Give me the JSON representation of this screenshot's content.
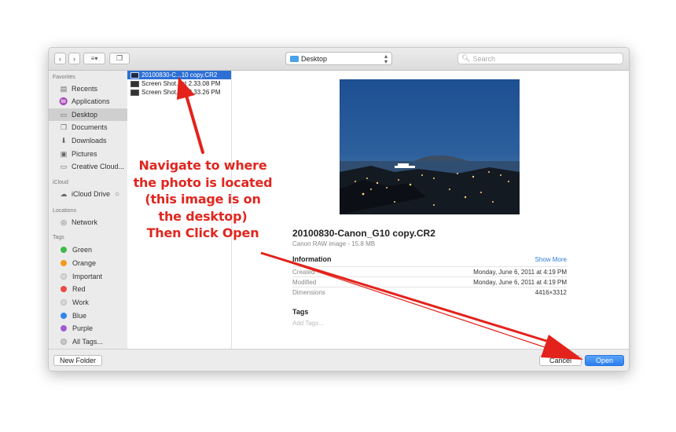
{
  "toolbar": {
    "back_icon": "chevron-left-icon",
    "forward_icon": "chevron-right-icon",
    "view_icon": "column-view-icon",
    "new_folder_icon": "new-folder-icon",
    "location": "Desktop",
    "search_placeholder": "Search"
  },
  "sidebar": {
    "favorites_header": "Favorites",
    "favorites": [
      {
        "label": "Recents",
        "icon": "recents-icon"
      },
      {
        "label": "Applications",
        "icon": "applications-icon"
      },
      {
        "label": "Desktop",
        "icon": "desktop-icon",
        "selected": true
      },
      {
        "label": "Documents",
        "icon": "documents-icon"
      },
      {
        "label": "Downloads",
        "icon": "downloads-icon"
      },
      {
        "label": "Pictures",
        "icon": "pictures-icon"
      },
      {
        "label": "Creative Cloud...",
        "icon": "folder-icon"
      }
    ],
    "icloud_header": "iCloud",
    "icloud": [
      {
        "label": "iCloud Drive",
        "icon": "cloud-icon"
      }
    ],
    "locations_header": "Locations",
    "locations": [
      {
        "label": "Network",
        "icon": "network-icon"
      }
    ],
    "tags_header": "Tags",
    "tags": [
      {
        "label": "Green",
        "color": "#3dbb4a"
      },
      {
        "label": "Orange",
        "color": "#f39a1e"
      },
      {
        "label": "Important",
        "color": "#d8d8d8"
      },
      {
        "label": "Red",
        "color": "#ec4a46"
      },
      {
        "label": "Work",
        "color": "#d8d8d8"
      },
      {
        "label": "Blue",
        "color": "#2f86e8"
      },
      {
        "label": "Purple",
        "color": "#a35ad0"
      },
      {
        "label": "All Tags...",
        "color": "#c8c8c8"
      }
    ]
  },
  "files": [
    {
      "name": "20100830-C...10 copy.CR2",
      "selected": true
    },
    {
      "name": "Screen Shot...at 2.33.08 PM"
    },
    {
      "name": "Screen Shot...at 2.33.26 PM"
    }
  ],
  "preview": {
    "title": "20100830-Canon_G10 copy.CR2",
    "subtitle": "Canon RAW image - 15.8 MB",
    "info_header": "Information",
    "show_more": "Show More",
    "rows": [
      {
        "key": "Created",
        "value": "Monday, June 6, 2011 at 4:19 PM"
      },
      {
        "key": "Modified",
        "value": "Monday, June 6, 2011 at 4:19 PM"
      },
      {
        "key": "Dimensions",
        "value": "4416×3312"
      }
    ],
    "tags_header": "Tags",
    "tags_placeholder": "Add Tags..."
  },
  "bottom": {
    "new_folder": "New Folder",
    "cancel": "Cancel",
    "open": "Open"
  },
  "annotation": {
    "lines": [
      "Navigate to where",
      "the photo is located",
      "(this image is on",
      "the desktop)",
      "Then Click Open"
    ],
    "color": "#e0261f"
  }
}
